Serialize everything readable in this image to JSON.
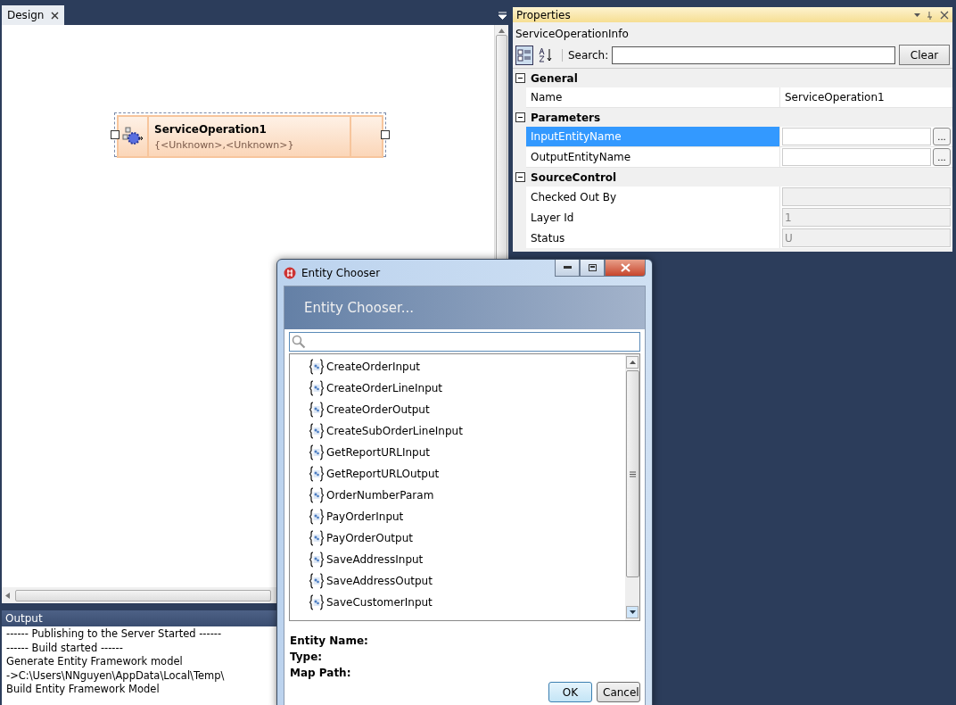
{
  "design_tab": {
    "label": "Design",
    "selected": true
  },
  "design_node": {
    "title": "ServiceOperation1",
    "subtitle": "{<Unknown>,<Unknown>}",
    "selected": true
  },
  "output": {
    "title": "Output",
    "lines": [
      "------ Publishing to the Server Started ------",
      "------ Build started ------",
      "Generate Entity Framework model",
      "->C:\\Users\\NNguyen\\AppData\\Local\\Temp\\",
      "Build Entity Framework Model"
    ]
  },
  "properties": {
    "title": "Properties",
    "object": "ServiceOperationInfo",
    "search_label": "Search:",
    "clear_button": "Clear",
    "categories": [
      {
        "name": "General",
        "expanded": true,
        "rows": [
          {
            "kind": "text",
            "name": "Name",
            "value": "ServiceOperation1",
            "selected": false
          }
        ]
      },
      {
        "name": "Parameters",
        "expanded": true,
        "rows": [
          {
            "kind": "picker",
            "name": "InputEntityName",
            "button": "...",
            "selected": true
          },
          {
            "kind": "picker",
            "name": "OutputEntityName",
            "button": "...",
            "selected": false
          }
        ]
      },
      {
        "name": "SourceControl",
        "expanded": true,
        "rows": [
          {
            "kind": "readonly",
            "name": "Checked Out By",
            "selected": false
          },
          {
            "kind": "readonly",
            "name": "Layer Id",
            "value": "1",
            "selected": false
          },
          {
            "kind": "readonly",
            "name": "Status",
            "value": "U",
            "selected": false
          }
        ]
      }
    ]
  },
  "dialog": {
    "title": "Entity Chooser",
    "header": "Entity Chooser...",
    "items": [
      "CreateOrderInput",
      "CreateOrderLineInput",
      "CreateOrderOutput",
      "CreateSubOrderLineInput",
      "GetReportURLInput",
      "GetReportURLOutput",
      "OrderNumberParam",
      "PayOrderInput",
      "PayOrderOutput",
      "SaveAddressInput",
      "SaveAddressOutput",
      "SaveCustomerInput"
    ],
    "details": [
      "Entity Name:",
      "Type:",
      "Map Path:"
    ],
    "buttons": [
      {
        "label": "OK",
        "default": true
      },
      {
        "label": "Cancel",
        "default": false
      }
    ]
  }
}
